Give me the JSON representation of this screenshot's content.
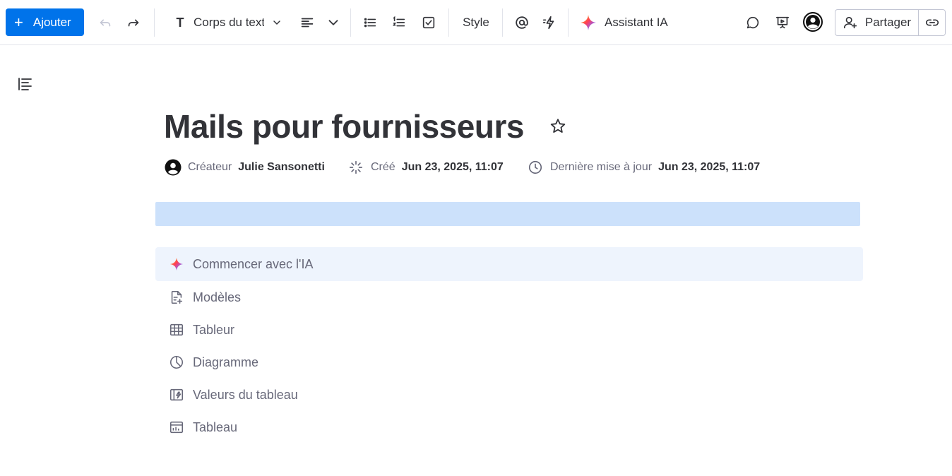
{
  "toolbar": {
    "add_label": "Ajouter",
    "text_style_label": "Corps du texte",
    "style_label": "Style",
    "ai_assistant_label": "Assistant IA",
    "share_label": "Partager"
  },
  "document": {
    "title": "Mails pour fournisseurs",
    "creator_label": "Créateur",
    "creator_name": "Julie Sansonetti",
    "created_label": "Créé",
    "created_date": "Jun 23, 2025, 11:07",
    "updated_label": "Dernière mise à jour",
    "updated_date": "Jun 23, 2025, 11:07"
  },
  "menu": {
    "items": [
      {
        "label": "Commencer avec l'IA",
        "icon": "sparkle-icon"
      },
      {
        "label": "Modèles",
        "icon": "template-icon"
      },
      {
        "label": "Tableur",
        "icon": "grid-icon"
      },
      {
        "label": "Diagramme",
        "icon": "pie-chart-icon"
      },
      {
        "label": "Valeurs du tableau",
        "icon": "board-values-icon"
      },
      {
        "label": "Tableau",
        "icon": "board-icon"
      }
    ]
  },
  "colors": {
    "primary": "#0073ea",
    "highlight": "#cce1fb",
    "active_item_bg": "#eef4fd",
    "text_dark": "#323338",
    "text_muted": "#676879"
  }
}
